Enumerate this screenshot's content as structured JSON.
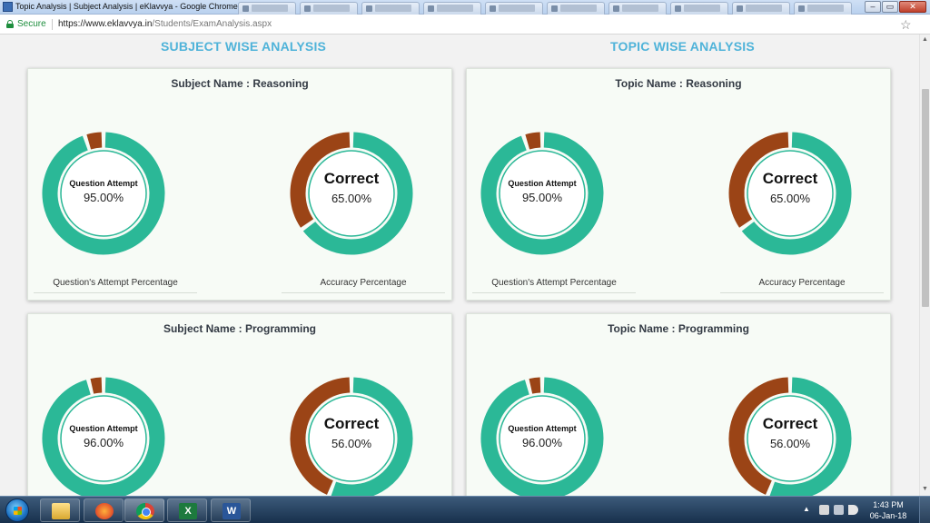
{
  "window": {
    "title": "Topic Analysis | Subject Analysis | eKlavvya - Google Chrome"
  },
  "address": {
    "secure_label": "Secure",
    "url_host": "https://www.eklavvya.in",
    "url_path": "/Students/ExamAnalysis.aspx"
  },
  "headings": {
    "subject": "SUBJECT WISE ANALYSIS",
    "topic": "TOPIC WISE ANALYSIS"
  },
  "cards": [
    {
      "title": "Subject Name : Reasoning",
      "attempt_label": "Question Attempt",
      "attempt_percent_text": "95.00%",
      "attempt_value": 95,
      "correct_label": "Correct",
      "correct_percent_text": "65.00%",
      "correct_value": 65,
      "caption_left": "Question's Attempt Percentage",
      "caption_right": "Accuracy Percentage"
    },
    {
      "title": "Topic Name : Reasoning",
      "attempt_label": "Question Attempt",
      "attempt_percent_text": "95.00%",
      "attempt_value": 95,
      "correct_label": "Correct",
      "correct_percent_text": "65.00%",
      "correct_value": 65,
      "caption_left": "Question's Attempt Percentage",
      "caption_right": "Accuracy Percentage"
    },
    {
      "title": "Subject Name : Programming",
      "attempt_label": "Question Attempt",
      "attempt_percent_text": "96.00%",
      "attempt_value": 96,
      "correct_label": "Correct",
      "correct_percent_text": "56.00%",
      "correct_value": 56,
      "caption_left": "",
      "caption_right": ""
    },
    {
      "title": "Topic Name : Programming",
      "attempt_label": "Question Attempt",
      "attempt_percent_text": "96.00%",
      "attempt_value": 96,
      "correct_label": "Correct",
      "correct_percent_text": "56.00%",
      "correct_value": 56,
      "caption_left": "",
      "caption_right": ""
    }
  ],
  "colors": {
    "primary": "#2bb897",
    "remainder": "#9b4416",
    "heading": "#4fb3d9"
  },
  "taskbar": {
    "clock_time": "1:43 PM",
    "clock_date": "06-Jan-18",
    "excel_letter": "X",
    "word_letter": "W"
  }
}
